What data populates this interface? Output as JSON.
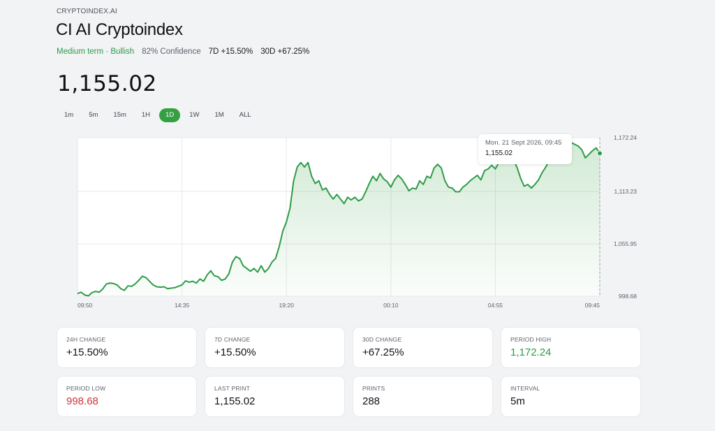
{
  "header": {
    "brand": "CRYPTOINDEX.AI",
    "title": "CI AI Cryptoindex",
    "outlook": "Medium term · Bullish",
    "confidence": "82% Confidence",
    "change_7d": "7D +15.50%",
    "change_30d": "30D +67.25%",
    "price": "1,155.02"
  },
  "ranges": [
    {
      "label": "1m",
      "active": false
    },
    {
      "label": "5m",
      "active": false
    },
    {
      "label": "15m",
      "active": false
    },
    {
      "label": "1H",
      "active": false
    },
    {
      "label": "1D",
      "active": true
    },
    {
      "label": "1W",
      "active": false
    },
    {
      "label": "1M",
      "active": false
    },
    {
      "label": "ALL",
      "active": false
    }
  ],
  "tooltip": {
    "date": "Mon. 21 Sept 2026, 09:45",
    "value": "1,155.02"
  },
  "colors": {
    "accent": "#34a042",
    "line": "#2e9b48",
    "negative": "#d0343a"
  },
  "chart_data": {
    "type": "area",
    "x_ticks": [
      "09:50",
      "14:35",
      "19:20",
      "00:10",
      "04:55",
      "09:45"
    ],
    "y_ticks": [
      "1,172.24",
      "1,113.23",
      "1,055.95",
      "998.68"
    ],
    "ylim": [
      998.68,
      1172.24
    ],
    "grid": true,
    "series": [
      {
        "values": [
          1001.5,
          1003.0,
          1000.0,
          999.0,
          1002.5,
          1004.0,
          1003.0,
          1006.5,
          1012.0,
          1013.0,
          1012.5,
          1011.0,
          1007.0,
          1005.0,
          1010.0,
          1009.5,
          1012.0,
          1016.0,
          1020.5,
          1019.0,
          1015.0,
          1011.0,
          1009.0,
          1008.5,
          1009.0,
          1007.0,
          1007.5,
          1008.0,
          1009.5,
          1011.0,
          1015.5,
          1014.0,
          1015.0,
          1013.0,
          1017.5,
          1015.0,
          1022.0,
          1026.5,
          1021.0,
          1020.0,
          1016.0,
          1017.5,
          1023.0,
          1036.0,
          1042.0,
          1040.0,
          1032.0,
          1029.0,
          1026.0,
          1029.0,
          1025.0,
          1032.0,
          1025.0,
          1029.0,
          1036.0,
          1040.0,
          1053.0,
          1070.0,
          1080.0,
          1095.0,
          1125.0,
          1140.0,
          1145.0,
          1140.0,
          1145.0,
          1130.0,
          1122.0,
          1125.0,
          1115.0,
          1117.0,
          1110.0,
          1105.0,
          1110.0,
          1105.0,
          1100.0,
          1107.0,
          1104.0,
          1107.0,
          1103.0,
          1105.0,
          1113.0,
          1122.0,
          1130.0,
          1125.0,
          1133.0,
          1127.0,
          1124.0,
          1118.0,
          1126.0,
          1131.0,
          1127.0,
          1121.0,
          1114.0,
          1117.0,
          1116.0,
          1125.0,
          1121.0,
          1130.0,
          1128.0,
          1139.0,
          1143.0,
          1139.0,
          1125.0,
          1118.0,
          1117.0,
          1113.0,
          1113.0,
          1118.0,
          1121.0,
          1125.0,
          1128.0,
          1131.0,
          1126.0,
          1136.0,
          1138.0,
          1142.0,
          1138.0,
          1145.0,
          1154.0,
          1149.0,
          1152.0,
          1148.0,
          1140.0,
          1128.0,
          1119.0,
          1121.0,
          1117.0,
          1121.0,
          1126.0,
          1134.0,
          1140.0,
          1147.0,
          1152.0,
          1158.0,
          1163.0,
          1166.0,
          1160.0,
          1167.0,
          1165.0,
          1163.0,
          1159.0,
          1150.0,
          1154.0,
          1158.0,
          1161.0,
          1155.02
        ]
      }
    ]
  },
  "cards": [
    {
      "label": "24H CHANGE",
      "value": "+15.50%",
      "tone": ""
    },
    {
      "label": "7D CHANGE",
      "value": "+15.50%",
      "tone": ""
    },
    {
      "label": "30D CHANGE",
      "value": "+67.25%",
      "tone": ""
    },
    {
      "label": "PERIOD HIGH",
      "value": "1,172.24",
      "tone": "pos"
    },
    {
      "label": "PERIOD LOW",
      "value": "998.68",
      "tone": "neg"
    },
    {
      "label": "LAST PRINT",
      "value": "1,155.02",
      "tone": ""
    },
    {
      "label": "PRINTS",
      "value": "288",
      "tone": ""
    },
    {
      "label": "INTERVAL",
      "value": "5m",
      "tone": ""
    }
  ]
}
